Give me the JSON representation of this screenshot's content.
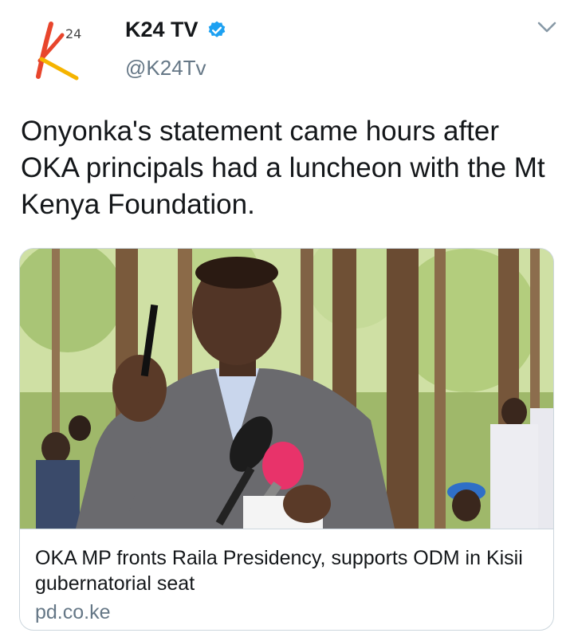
{
  "account": {
    "display_name": "K24 TV",
    "handle": "@K24Tv",
    "verified": true,
    "avatar_logo_text": "24"
  },
  "tweet": {
    "text": "Onyonka's statement came hours after OKA principals had a luncheon with the Mt Kenya Foundation."
  },
  "link_card": {
    "title": "OKA MP fronts Raila Presidency, supports ODM in Kisii gubernatorial seat",
    "domain": "pd.co.ke"
  },
  "icons": {
    "verified": "verified-badge-icon",
    "menu": "chevron-down-icon"
  },
  "colors": {
    "verified_blue": "#1da1f2",
    "secondary_text": "#657786",
    "logo_red": "#e8452c",
    "logo_yellow": "#f5b400"
  }
}
